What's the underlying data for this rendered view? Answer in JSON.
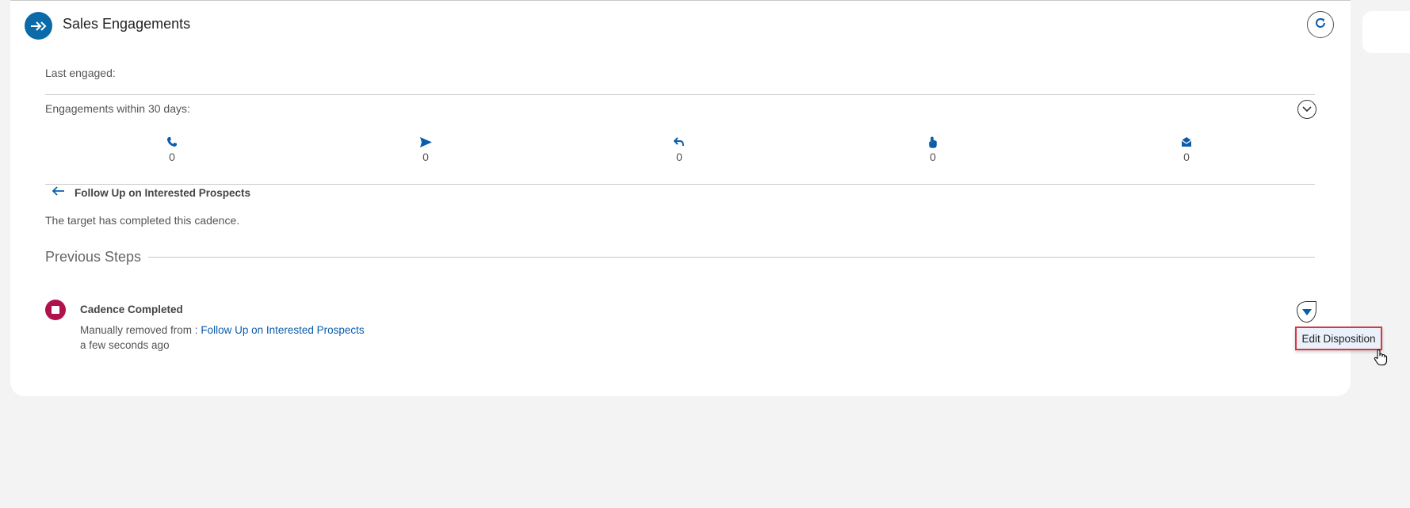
{
  "panel": {
    "title": "Sales Engagements",
    "header_icon": "double-chevron-arrow-icon",
    "refresh_icon": "refresh-icon"
  },
  "last_engaged": {
    "label": "Last engaged:"
  },
  "engagements": {
    "label": "Engagements within 30 days:",
    "expand_icon": "chevron-down-icon",
    "stats": [
      {
        "icon": "phone-icon",
        "count": "0"
      },
      {
        "icon": "send-icon",
        "count": "0"
      },
      {
        "icon": "reply-icon",
        "count": "0"
      },
      {
        "icon": "click-icon",
        "count": "0"
      },
      {
        "icon": "email-open-icon",
        "count": "0"
      }
    ]
  },
  "cadence": {
    "name": "Follow Up on Interested Prospects",
    "status_text": "The target has completed this cadence."
  },
  "previous_steps": {
    "title": "Previous Steps",
    "items": [
      {
        "title": "Cadence Completed",
        "detail_prefix": "Manually removed from :",
        "detail_link": "Follow Up on Interested Prospects",
        "time": "a few seconds ago"
      }
    ]
  },
  "menu": {
    "edit_disposition": "Edit Disposition"
  },
  "colors": {
    "accent": "#0b6aa8",
    "link": "#0b5cab",
    "step_icon": "#b0124d",
    "highlight": "#d9363e"
  }
}
